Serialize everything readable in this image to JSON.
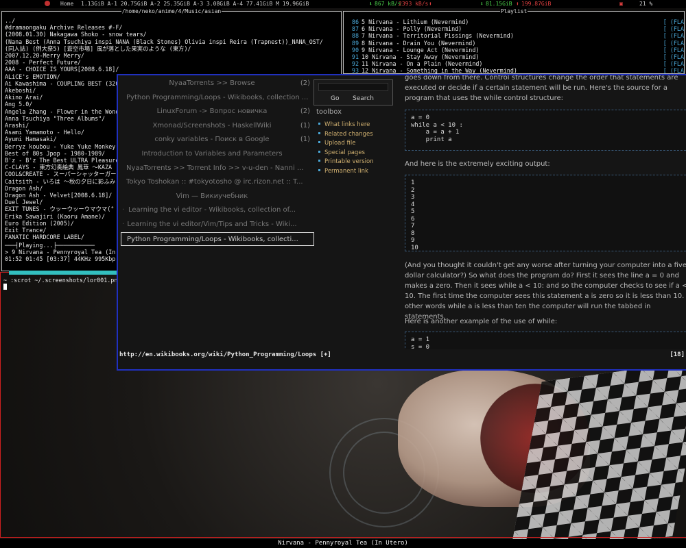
{
  "topbar": {
    "home": "Home",
    "disks": "1.13GiB A-1 20.75GiB A-2 25.35GiB A-3  3.08GiB A-4 77.41GiB M 19.96GiB",
    "net_down": "867 kB/s",
    "net_up": "2393 kB/s",
    "total_down": "81.15GiB",
    "total_up": "199.87GiB",
    "volume": "21 %"
  },
  "files": {
    "title": "/home/neko/anime/4/Music/asian",
    "entries": [
      "../",
      "#dramaongaku Archive Releases #-F/",
      "(2008.01.30) Nakagawa Shoko - snow tears/",
      "(Nana Best (Anna Tsuchiya inspi NANA (Black Stones)  Olivia inspi Reira (Trapnest))_NANA_OST/",
      "(同人誌) (例大祭5) [蒼空市場] 風が落とした果実のような (東方)/",
      "2007.12.20-Merry Merry/",
      "2008 - Perfect Future/",
      "AAA - CHOICE IS YOURS[2008.6.18]/",
      "ALiCE's EMOTION/",
      "Ai Kawashima - COUPLING BEST (320)/",
      "Akeboshi/",
      "Akino Arai/",
      "Ang 5.0/",
      "Angela Zhang - Flower in the Wonder",
      "Anna Tsuchiya \"Three Albums\"/",
      "Arashi/",
      "Asami Yamamoto - Hello/",
      "Ayumi Hamasaki/",
      "Berryz koubou - Yuke Yuke Monkey Da",
      "Best of 80s Jpop - 1980-1989/",
      "B'z - B'z The Best ULTRA Pleasure[2",
      "C-CLAYS - 東方幻奏絵典  鳳華 ～KAZA",
      "COOL&CREATE - スーパーシャッターガー",
      "Caitsith - いろは ～秋の夕日に影ふみ",
      "Dragon Ash/",
      "Dragon Ash - Velvet[2008.6.18]/",
      "Duel Jewel/",
      "EXIT TUNES - ウッーウッーウマウマ(°",
      "Erika Sawajiri (Kaoru Amane)/",
      "Euro Edition (2005)/",
      "Exit Trance/",
      "FANATIC HARDCORE LABEL/"
    ],
    "playing_label": "Playing...",
    "now_playing": " > 9 Nirvana - Pennyroyal Tea (In U",
    "time_info": "01:52 01:45 [03:37]   44KHz  995Kbp",
    "progress": 0.52
  },
  "playlist": {
    "title": "Playlist",
    "rows": [
      {
        "num": "86",
        "title": "5 Nirvana - Lithium (Nevermind)",
        "flag": "[      (FLA"
      },
      {
        "num": "87",
        "title": "6 Nirvana - Polly (Nevermind)",
        "flag": "[      (FLA"
      },
      {
        "num": "88",
        "title": "7 Nirvana - Territorial Pissings (Nevermind)",
        "flag": "[      (FLA"
      },
      {
        "num": "89",
        "title": "8 Nirvana - Drain You (Nevermind)",
        "flag": "[      (FLA"
      },
      {
        "num": "90",
        "title": "9 Nirvana - Lounge Act (Nevermind)",
        "flag": "[      (FLA"
      },
      {
        "num": "91",
        "title": "10 Nirvana - Stay Away (Nevermind)",
        "flag": "[      (FLA"
      },
      {
        "num": "92",
        "title": "11 Nirvana - On a Plain (Nevermind)",
        "flag": "[      (FLA"
      },
      {
        "num": "93",
        "title": "12 Nirvana - Something in the Way (Nevermind)",
        "flag": "[      (FLA"
      }
    ]
  },
  "terminal": {
    "command": "~ :scrot ~/.screenshots/lor001.png"
  },
  "browser": {
    "tabs": [
      {
        "label": "NyaaTorrents >> Browse",
        "count": "(2)"
      },
      {
        "label": "Python Programming/Loops - Wikibooks, collection ...",
        "count": ""
      },
      {
        "label": "LinuxForum -> Вопрос новичка",
        "count": "(2)"
      },
      {
        "label": "Xmonad/Screenshots - HaskellWiki",
        "count": "(1)"
      },
      {
        "label": "conky variables - Поиск в Google",
        "count": "(1)"
      },
      {
        "label": "Introduction to Variables and Parameters",
        "count": ""
      },
      {
        "label": "NyaaTorrents >> Torrent Info >> v-u-den - Nanni ...",
        "count": ""
      },
      {
        "label": "Tokyo Toshokan :: #tokyotosho @ irc.rizon.net :: T...",
        "count": ""
      },
      {
        "label": "Vim — Викиучебник",
        "count": ""
      },
      {
        "label": "Learning the vi editor - Wikibooks, collection of...",
        "count": ""
      },
      {
        "label": "Learning the vi editor/Vim/Tips and Tricks - Wiki...",
        "count": ""
      },
      {
        "label": "Python Programming/Loops - Wikibooks, collecti...",
        "count": ""
      }
    ],
    "search": {
      "go": "Go",
      "search": "Search",
      "placeholder": ""
    },
    "toolbox_title": "toolbox",
    "toolbox": [
      "What links here",
      "Related changes",
      "Upload file",
      "Special pages",
      "Printable version",
      "Permanent link"
    ],
    "article": {
      "p1": "goes down from there. Control structures change the order that statements are executed or decide if a certain statement will be run. Here's the source for a program that uses the while control structure:",
      "code1": "a = 0\nwhile a < 10 :\n    a = a + 1\n    print a",
      "p2": "And here is the extremely exciting output:",
      "output": "1\n2\n3\n4\n5\n6\n7\n8\n9\n10",
      "p3": "(And you thought it couldn't get any worse after turning your computer into a five dollar calculator?) So what does the program do? First it sees the line a = 0 and makes a zero. Then it sees while a < 10: and so the computer checks to see if a < 10. The first time the computer sees this statement a is zero so it is less than 10. In other words while a is less than ten the computer will run the tabbed in statements.",
      "p4": "Here is another example of the use of while:",
      "code2": "a = 1\ns = 0"
    },
    "status_url": "http://en.wikibooks.org/wiki/Python_Programming/Loops [+]",
    "status_pos": "[18]"
  },
  "bottombar": {
    "song": "Nirvana - Pennyroyal Tea (In Utero)"
  },
  "colors": {
    "browser_border": "#2030c0",
    "term_border": "#d02020",
    "progress": "#33bfbf",
    "accent_blue": "#4aa8d8",
    "toolbox_link": "#d0b070"
  },
  "icons": [
    "volume-icon",
    "net-down-arrow-icon",
    "net-up-arrow-icon",
    "record-icon"
  ]
}
